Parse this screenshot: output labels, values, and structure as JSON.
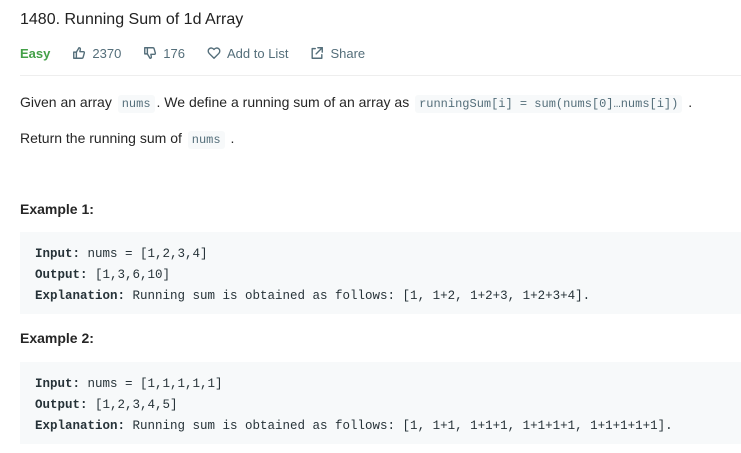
{
  "problem": {
    "title": "1480. Running Sum of 1d Array",
    "difficulty": "Easy",
    "likes": "2370",
    "dislikes": "176",
    "add_to_list": "Add to List",
    "share": "Share"
  },
  "description": {
    "p1_before": "Given an array",
    "p1_code1": "nums",
    "p1_middle": ". We define a running sum of an array as",
    "p1_code2": "runningSum[i] = sum(nums[0]…nums[i])",
    "p1_after": ".",
    "p2_before": "Return the running sum of",
    "p2_code": "nums",
    "p2_after": "."
  },
  "examples": [
    {
      "heading": "Example 1:",
      "input_label": "Input:",
      "input_value": " nums = [1,2,3,4]",
      "output_label": "Output:",
      "output_value": " [1,3,6,10]",
      "explanation_label": "Explanation:",
      "explanation_value": " Running sum is obtained as follows: [1, 1+2, 1+2+3, 1+2+3+4]."
    },
    {
      "heading": "Example 2:",
      "input_label": "Input:",
      "input_value": " nums = [1,1,1,1,1]",
      "output_label": "Output:",
      "output_value": " [1,2,3,4,5]",
      "explanation_label": "Explanation:",
      "explanation_value": " Running sum is obtained as follows: [1, 1+1, 1+1+1, 1+1+1+1, 1+1+1+1+1]."
    }
  ],
  "icons": {
    "likes": "thumbs-up-icon",
    "dislikes": "thumbs-down-icon",
    "add_to_list": "heart-icon",
    "share": "share-icon"
  },
  "colors": {
    "easy": "#43a047",
    "meta": "#546e7a",
    "code_bg": "#f7f9fa"
  }
}
